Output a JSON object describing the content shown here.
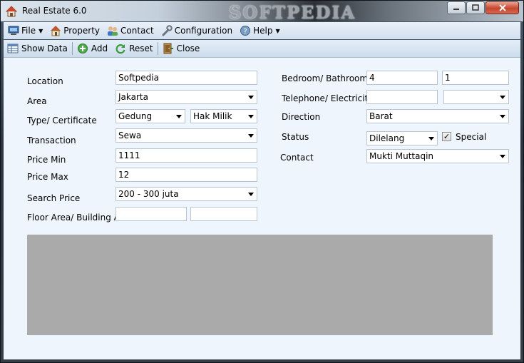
{
  "window": {
    "title": "Real Estate 6.0",
    "watermark": "SOFTPEDIA"
  },
  "menu": [
    {
      "label": "File",
      "icon": "computer-icon",
      "dropdown": true
    },
    {
      "label": "Property",
      "icon": "house-icon",
      "dropdown": false
    },
    {
      "label": "Contact",
      "icon": "people-icon",
      "dropdown": false
    },
    {
      "label": "Configuration",
      "icon": "wrench-icon",
      "dropdown": false
    },
    {
      "label": "Help",
      "icon": "help-icon",
      "dropdown": true
    }
  ],
  "toolbar": {
    "show_data": "Show Data",
    "add": "Add",
    "reset": "Reset",
    "close": "Close"
  },
  "form": {
    "location_label": "Location",
    "location_value": "Softpedia",
    "area_label": "Area",
    "area_value": "Jakarta",
    "type_label": "Type/ Certificate",
    "type_value": "Gedung",
    "certificate_value": "Hak Milik",
    "transaction_label": "Transaction",
    "transaction_value": "Sewa",
    "price_min_label": "Price Min",
    "price_min_value": "1111",
    "price_max_label": "Price Max",
    "price_max_value": "12",
    "search_price_label": "Search Price",
    "search_price_value": "200 - 300 juta",
    "floor_area_label": "Floor Area/ Building Area",
    "floor_area_value": "",
    "building_area_value": "",
    "bedroom_label": "Bedroom/ Bathroom",
    "bedroom_value": "4",
    "bathroom_value": "1",
    "telephone_label": "Telephone/ Electricity",
    "telephone_value": "",
    "electricity_value": "",
    "direction_label": "Direction",
    "direction_value": "Barat",
    "status_label": "Status",
    "status_value": "Dilelang",
    "special_label": "Special",
    "special_checked": "✓",
    "contact_label": "Contact",
    "contact_value": "Mukti Muttaqin"
  }
}
